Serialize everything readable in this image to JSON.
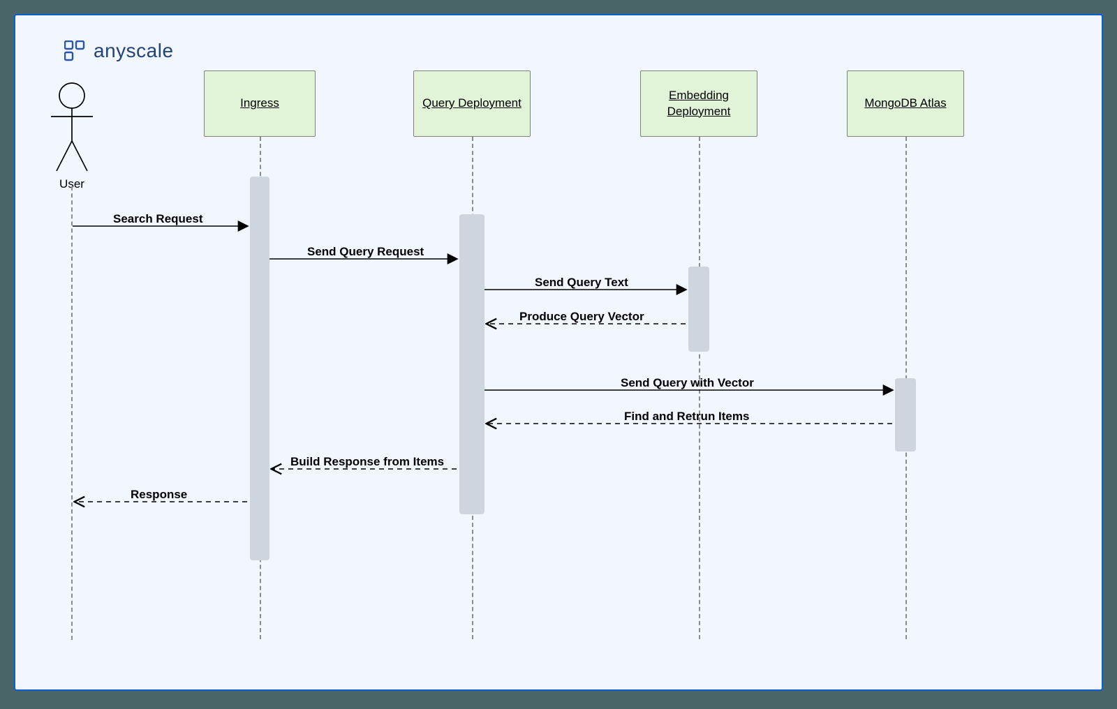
{
  "brand": {
    "name": "anyscale"
  },
  "actor": {
    "label": "User"
  },
  "participants": {
    "ingress": "Ingress",
    "query": "Query Deployment",
    "embedding": "Embedding Deployment",
    "mongodb": "MongoDB Atlas"
  },
  "messages": {
    "m1": "Search Request",
    "m2": "Send Query Request",
    "m3": "Send Query Text",
    "m4": "Produce Query Vector",
    "m5": "Send Query with Vector",
    "m6": "Find and Retrun Items",
    "m7": "Build Response from Items",
    "m8": "Response"
  },
  "chart_data": {
    "type": "sequence-diagram",
    "actors": [
      "User"
    ],
    "participants": [
      "Ingress",
      "Query Deployment",
      "Embedding Deployment",
      "MongoDB Atlas"
    ],
    "messages": [
      {
        "from": "User",
        "to": "Ingress",
        "label": "Search Request",
        "style": "solid"
      },
      {
        "from": "Ingress",
        "to": "Query Deployment",
        "label": "Send Query Request",
        "style": "solid"
      },
      {
        "from": "Query Deployment",
        "to": "Embedding Deployment",
        "label": "Send Query Text",
        "style": "solid"
      },
      {
        "from": "Embedding Deployment",
        "to": "Query Deployment",
        "label": "Produce Query Vector",
        "style": "dashed"
      },
      {
        "from": "Query Deployment",
        "to": "MongoDB Atlas",
        "label": "Send Query with Vector",
        "style": "solid"
      },
      {
        "from": "MongoDB Atlas",
        "to": "Query Deployment",
        "label": "Find and Retrun Items",
        "style": "dashed"
      },
      {
        "from": "Query Deployment",
        "to": "Ingress",
        "label": "Build Response from Items",
        "style": "dashed"
      },
      {
        "from": "Ingress",
        "to": "User",
        "label": "Response",
        "style": "dashed"
      }
    ]
  }
}
